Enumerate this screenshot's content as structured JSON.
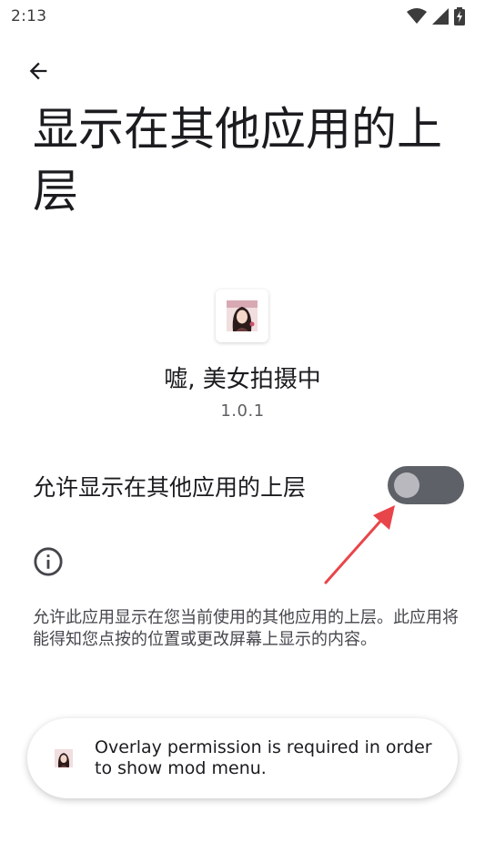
{
  "status_bar": {
    "time": "2:13",
    "icons": [
      "wifi-icon",
      "cellular-signal-icon",
      "battery-charging-icon"
    ]
  },
  "header": {
    "back_icon": "arrow-back-icon",
    "title": "显示在其他应用的上层"
  },
  "app": {
    "name": "嘘, 美女拍摄中",
    "version": "1.0.1",
    "icon": "app-portrait-icon"
  },
  "permission": {
    "label": "允许显示在其他应用的上层",
    "enabled": false,
    "description": "允许此应用显示在您当前使用的其他应用的上层。此应用将能得知您点按的位置或更改屏幕上显示的内容。"
  },
  "info": {
    "icon": "info-icon"
  },
  "annotation": {
    "icon": "red-arrow-pointer",
    "color": "#e8454a"
  },
  "toast": {
    "icon": "app-portrait-icon",
    "message": "Overlay permission is required in order to show mod menu."
  },
  "colors": {
    "switch_track_off": "#5e6168",
    "switch_thumb_off": "#b8b8be",
    "text_primary": "#1c1b1f",
    "text_secondary": "#45464c"
  }
}
